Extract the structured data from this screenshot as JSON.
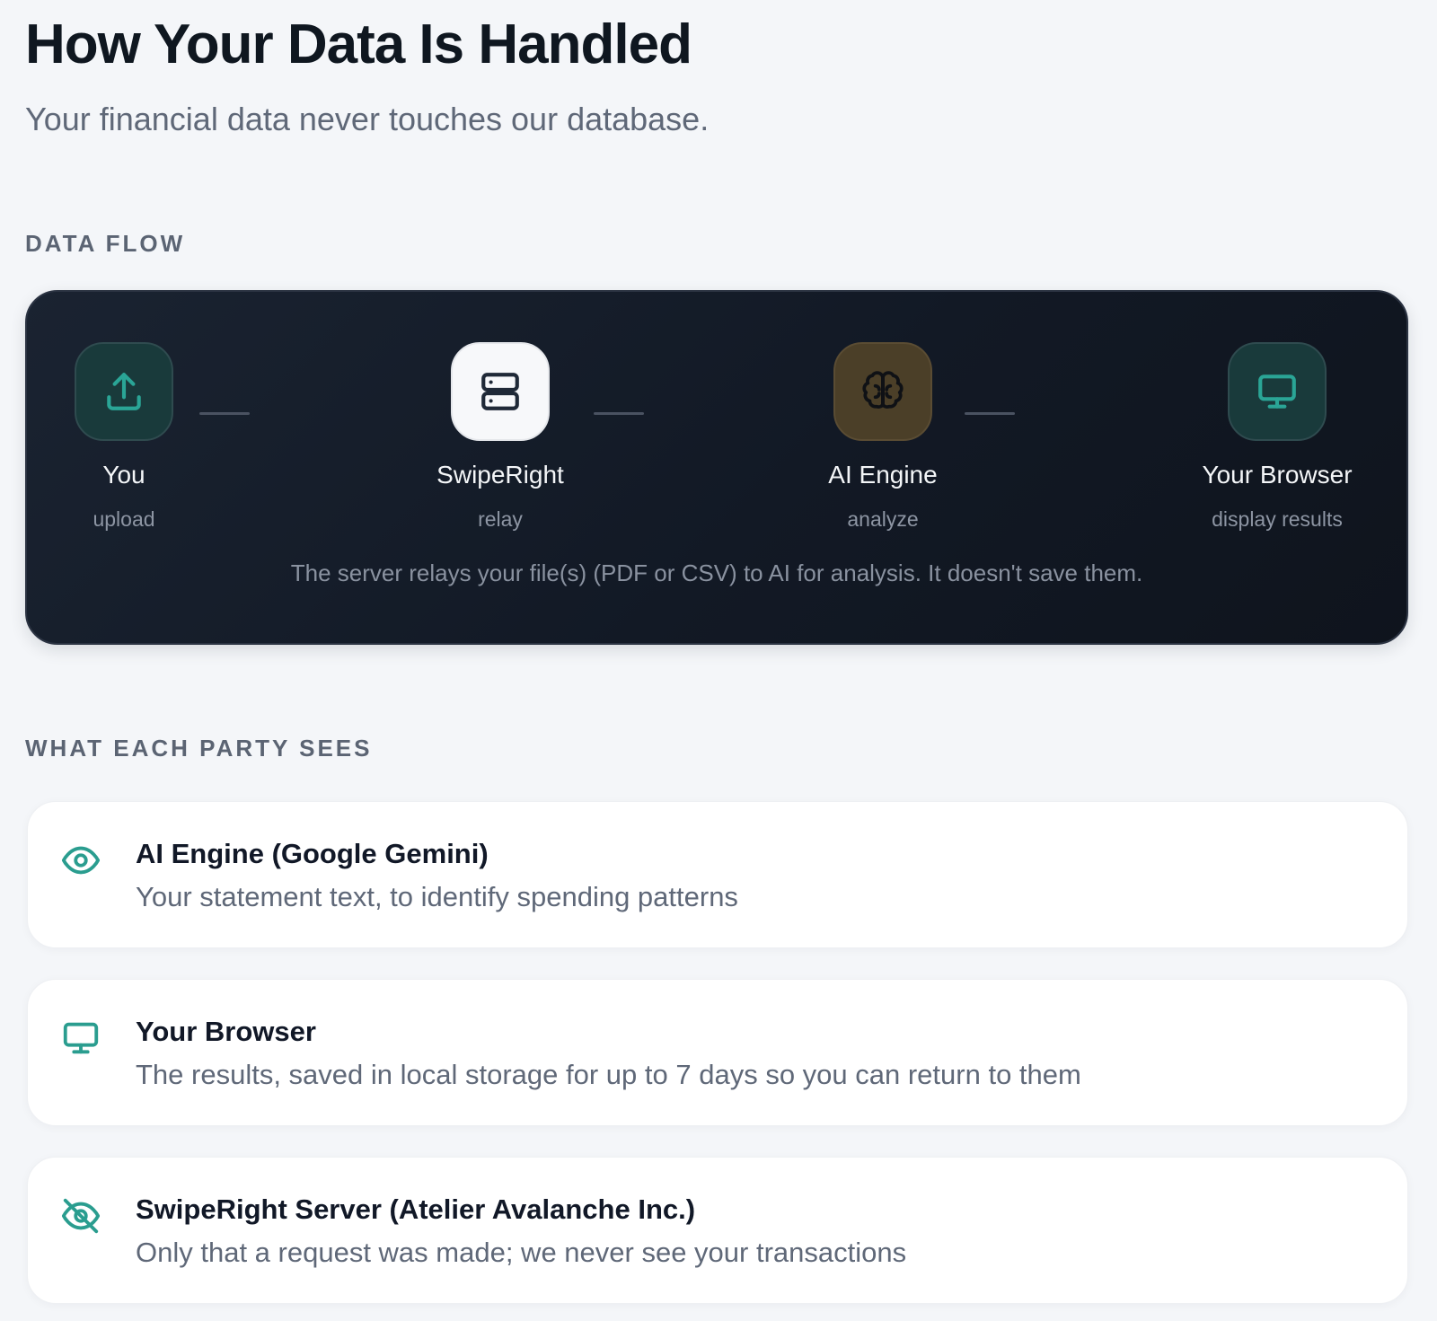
{
  "header": {
    "title": "How Your Data Is Handled",
    "subtitle": "Your financial data never touches our database."
  },
  "flow": {
    "section_label": "DATA FLOW",
    "nodes": [
      {
        "name": "You",
        "sub": "upload",
        "icon": "upload-icon"
      },
      {
        "name": "SwipeRight",
        "sub": "relay",
        "icon": "server-icon"
      },
      {
        "name": "AI Engine",
        "sub": "analyze",
        "icon": "brain-icon"
      },
      {
        "name": "Your Browser",
        "sub": "display results",
        "icon": "monitor-icon"
      }
    ],
    "caption": "The server relays your file(s) (PDF or CSV) to AI for analysis. It doesn't save them."
  },
  "parties": {
    "section_label": "WHAT EACH PARTY SEES",
    "items": [
      {
        "title": "AI Engine (Google Gemini)",
        "desc": "Your statement text, to identify spending patterns",
        "icon": "eye-icon"
      },
      {
        "title": "Your Browser",
        "desc": "The results, saved in local storage for up to 7 days so you can return to them",
        "icon": "monitor-icon"
      },
      {
        "title": "SwipeRight Server (Atelier Avalanche Inc.)",
        "desc": "Only that a request was made; we never see your transactions",
        "icon": "eye-off-icon"
      }
    ]
  },
  "colors": {
    "accent_teal": "#2a9d8f",
    "page_background": "#f4f6f9",
    "flow_card_background": "#141b27"
  }
}
